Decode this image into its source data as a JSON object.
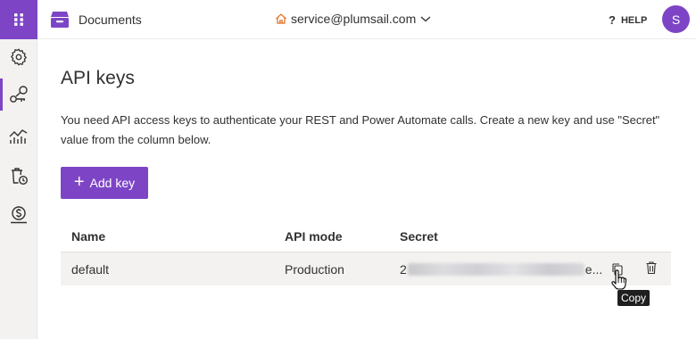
{
  "header": {
    "app_name": "Documents",
    "account_email": "service@plumsail.com",
    "help_label": "HELP",
    "avatar_initial": "S"
  },
  "sidebar": {
    "items": [
      {
        "icon": "gear-icon",
        "active": false
      },
      {
        "icon": "api-keys-icon",
        "active": true
      },
      {
        "icon": "chart-icon",
        "active": false
      },
      {
        "icon": "history-icon",
        "active": false
      },
      {
        "icon": "billing-icon",
        "active": false
      }
    ]
  },
  "main": {
    "title": "API keys",
    "description": "You need API access keys to authenticate your REST and Power Automate calls. Create a new key and use \"Secret\" value from the column below.",
    "add_button_label": "Add key"
  },
  "table": {
    "headers": [
      "Name",
      "API mode",
      "Secret"
    ],
    "rows": [
      {
        "name": "default",
        "api_mode": "Production",
        "secret_prefix": "2",
        "secret_suffix": "e..."
      }
    ]
  },
  "tooltip": {
    "text": "Copy"
  },
  "colors": {
    "accent": "#7d45c6"
  }
}
